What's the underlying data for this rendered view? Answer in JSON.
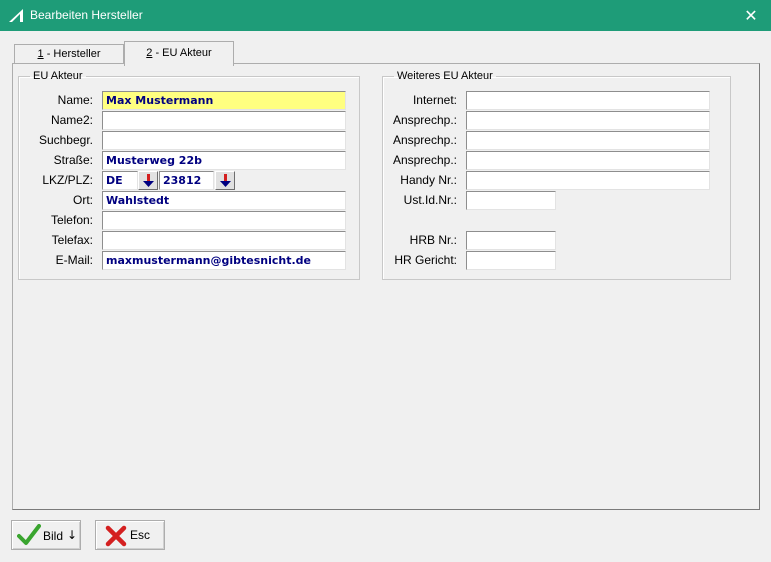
{
  "window": {
    "title": "Bearbeiten Hersteller",
    "close_glyph": "✕"
  },
  "tabs": [
    {
      "num": "1",
      "label": " - Hersteller",
      "active": false
    },
    {
      "num": "2",
      "label": " - EU Akteur",
      "active": true
    }
  ],
  "eu_akteur": {
    "legend": "EU Akteur",
    "labels": {
      "name": "Name:",
      "name2": "Name2:",
      "suchbegr": "Suchbegr.",
      "strasse": "Straße:",
      "lkz_plz": "LKZ/PLZ:",
      "ort": "Ort:",
      "telefon": "Telefon:",
      "telefax": "Telefax:",
      "email": "E-Mail:"
    },
    "values": {
      "name": "Max Mustermann",
      "name2": "",
      "suchbegr": "",
      "strasse": "Musterweg 22b",
      "lkz": "DE",
      "plz": "23812",
      "ort": "Wahlstedt",
      "telefon": "",
      "telefax": "",
      "email": "maxmustermann@gibtesnicht.de"
    }
  },
  "weiteres": {
    "legend": "Weiteres EU Akteur",
    "labels": {
      "internet": "Internet:",
      "ansprech1": "Ansprechp.:",
      "ansprech2": "Ansprechp.:",
      "ansprech3": "Ansprechp.:",
      "handy": "Handy Nr.:",
      "ustid": "Ust.Id.Nr.:",
      "hrb": "HRB Nr.:",
      "hrgericht": "HR Gericht:"
    },
    "values": {
      "internet": "",
      "ansprech1": "",
      "ansprech2": "",
      "ansprech3": "",
      "handy": "",
      "ustid": "",
      "hrb": "",
      "hrgericht": ""
    }
  },
  "buttons": {
    "bild_label": "Bild",
    "bild_arrow": "↓",
    "esc_label": "Esc"
  },
  "colors": {
    "titlebar": "#1e9c78",
    "highlight_field": "#ffff80",
    "field_text": "#000080",
    "check_green": "#3aa52f",
    "x_red": "#d42020"
  },
  "icons": [
    "app-icon",
    "close-icon",
    "arrow-down-icon",
    "checkmark-icon",
    "red-x-icon"
  ]
}
